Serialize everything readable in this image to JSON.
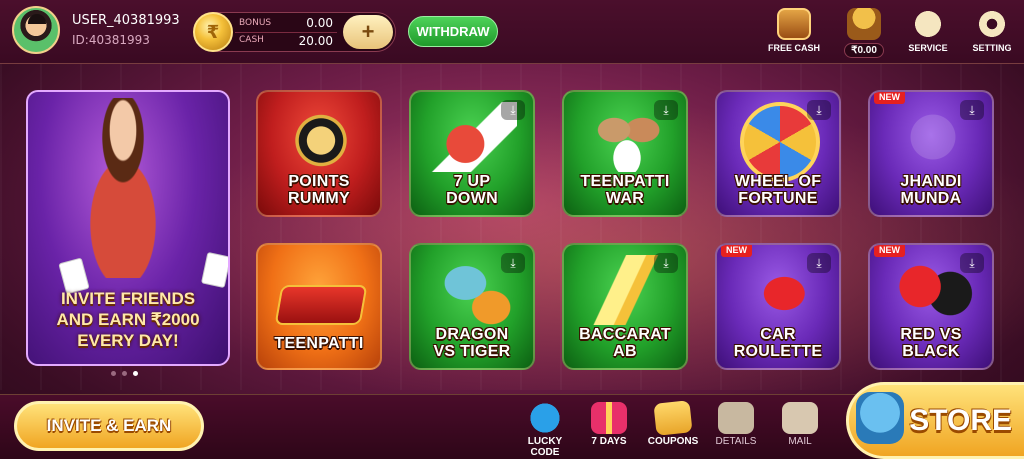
{
  "header": {
    "username": "USER_40381993",
    "user_id": "ID:40381993",
    "wallet": {
      "bonus_label": "BONUS",
      "bonus_value": "0.00",
      "cash_label": "CASH",
      "cash_value": "20.00",
      "add_label": "+",
      "coin_symbol": "₹"
    },
    "withdraw_label": "WITHDRAW",
    "free_cash_label": "FREE CASH",
    "balance_value": "₹0.00",
    "service_label": "SERVICE",
    "setting_label": "SETTING"
  },
  "promo": {
    "text_line1": "INVITE FRIENDS",
    "text_line2": "AND EARN ₹2000",
    "text_line3": "EVERY DAY!",
    "pages": 3,
    "active_page": 3
  },
  "games": [
    {
      "line1": "POINTS",
      "line2": "RUMMY",
      "color": "#c01e1e",
      "download": false,
      "is_new": false
    },
    {
      "line1": "7 UP",
      "line2": "DOWN",
      "color": "#22a12a",
      "download": true,
      "is_new": false
    },
    {
      "line1": "TEENPATTI",
      "line2": "WAR",
      "color": "#22a12a",
      "download": true,
      "is_new": false
    },
    {
      "line1": "WHEEL OF",
      "line2": "FORTUNE",
      "color": "#6a2ab8",
      "download": true,
      "is_new": false
    },
    {
      "line1": "JHANDI",
      "line2": "MUNDA",
      "color": "#6a2ab8",
      "download": true,
      "is_new": true
    },
    {
      "line1": "TEENPATTI",
      "line2": "",
      "color": "#f07016",
      "download": false,
      "is_new": false
    },
    {
      "line1": "DRAGON",
      "line2": "VS TIGER",
      "color": "#22a12a",
      "download": true,
      "is_new": false
    },
    {
      "line1": "BACCARAT",
      "line2": "AB",
      "color": "#22a12a",
      "download": true,
      "is_new": false
    },
    {
      "line1": "CAR",
      "line2": "ROULETTE",
      "color": "#6a2ab8",
      "download": true,
      "is_new": true
    },
    {
      "line1": "RED VS",
      "line2": "BLACK",
      "color": "#6a2ab8",
      "download": true,
      "is_new": true
    }
  ],
  "new_badge": "NEW",
  "download_symbol": "⤓",
  "footer": {
    "invite_label": "INVITE & EARN",
    "lucky_code_label": "LUCKY CODE",
    "seven_days_label": "7 DAYS",
    "coupons_label": "COUPONS",
    "details_label": "DETAILS",
    "mail_label": "MAIL",
    "store_label": "STORE"
  },
  "colors": {
    "accent_gold": "#f0a522",
    "withdraw_green": "#1f9a2a",
    "background": "#6a1c45"
  },
  "icons": [
    "avatar",
    "coin-icon",
    "treasure-chest-icon",
    "money-pot-icon",
    "chat-bubble-icon",
    "gear-icon",
    "download-icon",
    "telegram-icon",
    "gift-icon",
    "coupon-icon",
    "list-icon",
    "mail-icon",
    "wallet-bag-icon"
  ]
}
